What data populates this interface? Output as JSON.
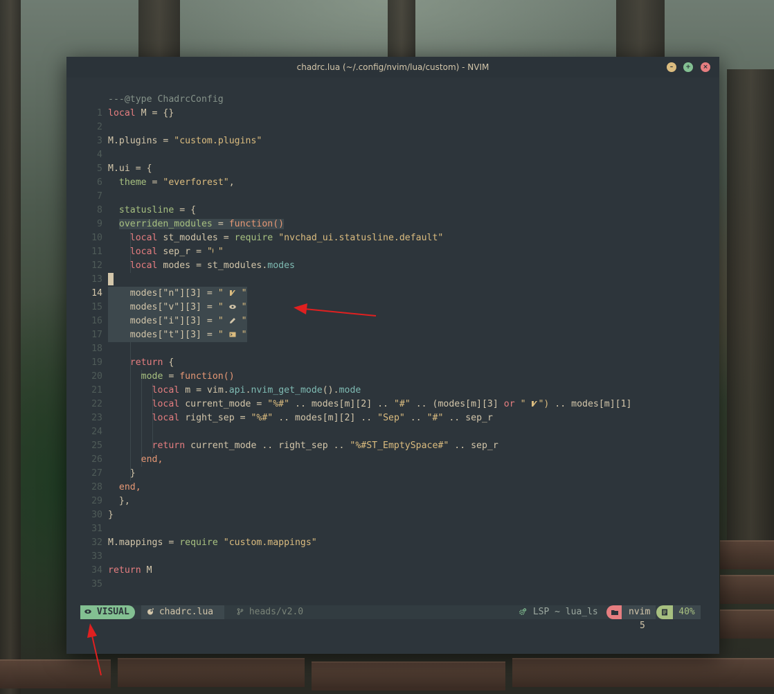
{
  "window": {
    "title": "chadrc.lua (~/.config/nvim/lua/custom) - NVIM",
    "buttons": {
      "minimize": "–",
      "maximize": "+",
      "close": "×"
    }
  },
  "editor": {
    "line_numbers": [
      "1",
      "2",
      "3",
      "4",
      "5",
      "6",
      "7",
      "8",
      "9",
      "10",
      "11",
      "12",
      "13",
      "14",
      "15",
      "16",
      "17",
      "18",
      "19",
      "20",
      "21",
      "22",
      "23",
      "24",
      "25",
      "26",
      "27",
      "28",
      "29",
      "30",
      "31",
      "32",
      "33",
      "34",
      "35"
    ],
    "t": {
      "l1": "---@type ChadrcConfig",
      "local": "local",
      "M": "M",
      "eq_brace": " = {}",
      "eq": " = ",
      "brace_open": "{",
      "brace_close": "}",
      "brace_close_comma": "},",
      "plugins_lhs": "M.plugins",
      "plugins_rhs": "\"custom.plugins\"",
      "ui_lhs": "M.ui",
      "theme": "theme",
      "theme_val": "\"everforest\"",
      "comma": ",",
      "statusline": "statusline",
      "overriden_modules": "overriden_modules",
      "function": "function",
      "function_call": "function()",
      "st_modules": "st_modules",
      "require": "require",
      "req_default": "\"nvchad_ui.statusline.default\"",
      "sep_r": "sep_r",
      "quote": "\"",
      "quote_sp": "\" ",
      "modes": "modes",
      "st_modules_dot": "st_modules.",
      "modes_n_key": "modes[\"n\"][3]",
      "modes_v_key": "modes[\"v\"][3]",
      "modes_i_key": "modes[\"i\"][3]",
      "modes_t_key": "modes[\"t\"][3]",
      "return": "return",
      "mode": "mode",
      "m": "m",
      "vim": "vim.",
      "api": "api",
      "dot": ".",
      "nvim_get_mode": "nvim_get_mode",
      "parens_dot": "().",
      "current_mode": "current_mode",
      "pct_hash": "\"%#\"",
      "concat": " .. ",
      "modes_m_2": "modes[m][2]",
      "hash": "\"#\"",
      "paren_open_modes_m_3": "(modes[m][3]",
      "or": " or ",
      "close_paren": "\")",
      "modes_m_1": "modes[m][1]",
      "right_sep": "right_sep",
      "sep_str": "\"Sep\"",
      "empty_space": "\"%#ST_EmptySpace#\"",
      "end_comma": "end,",
      "close_brace": "}",
      "mappings_lhs": "M.mappings",
      "mappings_rhs": "\"custom.mappings\""
    }
  },
  "statusline": {
    "mode": "VISUAL",
    "file": "chadrc.lua",
    "branch": "heads/v2.0",
    "lsp": "LSP ~ lua_ls",
    "dir": "nvim",
    "percent": "40%"
  },
  "cmdline": "5",
  "colors": {
    "bg": "#2d353b",
    "keyword": "#e67e80",
    "string": "#dbbc7f",
    "field": "#7fbbb3",
    "function": "#e69875",
    "number": "#d699b6",
    "comment": "#859289",
    "mode_visual": "#83c092",
    "annotation_arrow": "#e02020"
  }
}
